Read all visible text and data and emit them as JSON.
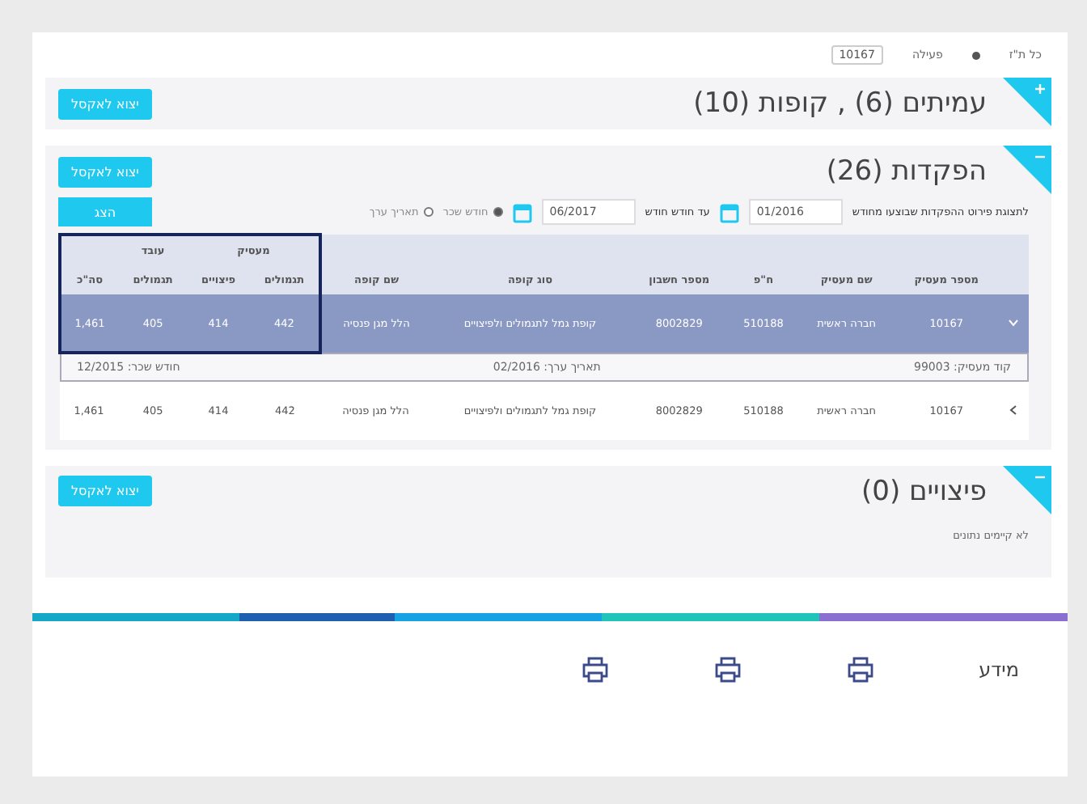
{
  "topbar": {
    "account": "10167",
    "status": "פעילה",
    "id_label": "כל ת\"ז"
  },
  "sections": [
    {
      "title": "עמיתים (6) , קופות (10)",
      "expanded": false,
      "export_button": "יצוא לאקסל"
    },
    {
      "title": "הפקדות (26)",
      "expanded": true,
      "export_button": "יצוא לאקסל"
    },
    {
      "title": "פיצויים (0)",
      "expanded": true,
      "export_button": "יצוא לאקסל"
    }
  ],
  "deposits": {
    "filter": {
      "from_label": "לתצוגת פירוט ההפקדות שבוצעו מחודש",
      "from_value": "01/2016",
      "to_label": "עד חודש חודש",
      "to_value": "06/2017",
      "radios": [
        {
          "label": "חודש שכר",
          "selected": true
        },
        {
          "label": "תאריך ערך",
          "selected": false
        }
      ],
      "show_button": "הצג"
    },
    "columns": [
      "מספר מעסיק",
      "שם מעסיק",
      "ח\"פ",
      "מספר חשבון",
      "סוג קופה",
      "שם קופה"
    ],
    "groups": [
      {
        "label": "מעסיק",
        "columns": [
          "תגמולים",
          "פיצויים"
        ]
      },
      {
        "label": "עובד",
        "columns": [
          "תגמולים"
        ]
      }
    ],
    "total_column": "סה\"כ",
    "rows": [
      {
        "expanded": true,
        "cells": [
          "10167",
          "חברה ראשית",
          "510188",
          "8002829",
          "קופת גמל לתגמולים ולפיצויים",
          "הלל מגן פנסיה",
          "442",
          "414",
          "405",
          "1,461"
        ],
        "details": [
          "קוד מעסיק: 99003",
          "תאריך ערך: 02/2016",
          "חודש שכר: 12/2015"
        ]
      },
      {
        "expanded": false,
        "cells": [
          "10167",
          "חברה ראשית",
          "510188",
          "8002829",
          "קופת גמל לתגמולים ולפיצויים",
          "הלל מגן פנסיה",
          "442",
          "414",
          "405",
          "1,461"
        ]
      }
    ]
  },
  "severance": {
    "empty_text": "לא קיימים נתונים"
  },
  "footer": {
    "label": "מידע"
  }
}
